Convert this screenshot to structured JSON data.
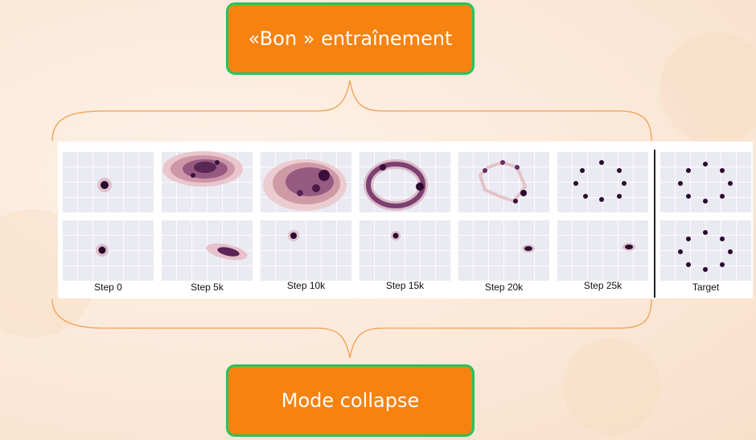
{
  "top_box": {
    "label": "«Bon » entraînement"
  },
  "bottom_box": {
    "label": "Mode collapse"
  },
  "figure": {
    "steps": [
      "Step 0",
      "Step 5k",
      "Step 10k",
      "Step 15k",
      "Step 20k",
      "Step 25k"
    ],
    "target_label": "Target"
  },
  "colors": {
    "box_fill": "#f68210",
    "box_border": "#22c55e",
    "brace": "#f0a050",
    "density": "#2a0a2f"
  }
}
